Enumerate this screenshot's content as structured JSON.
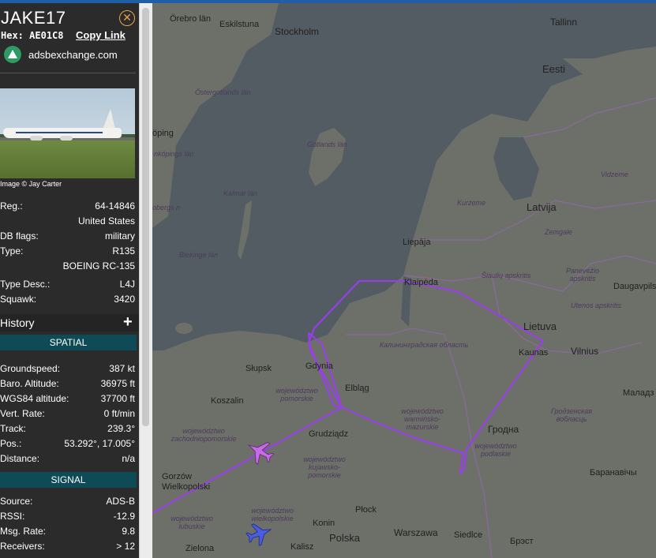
{
  "aircraft": {
    "callsign": "JAKE17",
    "hex_label": "Hex:",
    "hex": "AE01C8",
    "copy_link": "Copy Link",
    "source_site": "adsbexchange.com",
    "photo_credit": "Image © Jay Carter",
    "close_icon": "close-icon"
  },
  "info": [
    {
      "label": "Reg.:",
      "value": "64-14846"
    },
    {
      "label": "",
      "value": "United States"
    },
    {
      "label": "DB flags:",
      "value": "military"
    },
    {
      "label": "Type:",
      "value": "R135"
    },
    {
      "label": "",
      "value": "BOEING RC-135"
    },
    {
      "label": "Type Desc.:",
      "value": "L4J"
    },
    {
      "label": "Squawk:",
      "value": "3420"
    }
  ],
  "history": {
    "label": "History",
    "expand_icon": "+"
  },
  "spatial": {
    "title": "SPATIAL",
    "rows": [
      {
        "label": "Groundspeed:",
        "value": "387 kt"
      },
      {
        "label": "Baro. Altitude:",
        "value": "36975 ft"
      },
      {
        "label": "WGS84 altitude:",
        "value": "37700 ft"
      },
      {
        "label": "Vert. Rate:",
        "value": "0 ft/min"
      },
      {
        "label": "Track:",
        "value": "239.3°"
      },
      {
        "label": "Pos.:",
        "value": "53.292°, 17.005°"
      },
      {
        "label": "Distance:",
        "value": "n/a"
      }
    ]
  },
  "signal": {
    "title": "SIGNAL",
    "rows": [
      {
        "label": "Source:",
        "value": "ADS-B"
      },
      {
        "label": "RSSI:",
        "value": "-12.9"
      },
      {
        "label": "Msg. Rate:",
        "value": "9.8"
      },
      {
        "label": "Receivers:",
        "value": "> 12"
      }
    ]
  },
  "map": {
    "colors": {
      "land": "#6d7069",
      "water": "#545c63",
      "border": "#8a6a9a",
      "track": "#9b3cf0",
      "selected_plane": "#c86ae6",
      "other_plane": "#4a5ce0"
    },
    "labels": {
      "orebro": "Örebro län",
      "eskilstuna": "Eskilstuna",
      "stockholm": "Stockholm",
      "tallinn": "Tallinn",
      "eesti": "Eesti",
      "ostergotlands": "Östergotlands län",
      "gotlands": "Gotlands län",
      "kalmar": "Kalmar län",
      "jonkopings": "nköpings län",
      "oping": "öping",
      "kronobergs": "obergs n",
      "blekinge": "Blekinge län",
      "latvija": "Latvija",
      "vidzeme": "Vidzeme",
      "kurzeme": "Kurzeme",
      "zemgale": "Zemgale",
      "liepaja": "Liepāja",
      "siauliu": "Šiaulių apskritis",
      "panevezio": "Panevėžio apskritis",
      "daugavpils": "Daugavpils",
      "utenos": "Utenos apskritis",
      "klaipeda": "Klaipėda",
      "lietuva": "Lietuva",
      "kaunas": "Kaunas",
      "vilnius": "Vilnius",
      "kaliningrad": "Калининградская область",
      "slupsk": "Słupsk",
      "gdynia": "Gdynia",
      "elblag": "Elbląg",
      "koszalin": "Koszalin",
      "pomorskie": "województwo pomorskie",
      "warminsko": "województwo warmińsko-mazurskie",
      "zachodniopomorskie": "województwo zachodniopomorskie",
      "grudziadz": "Grudziądz",
      "kujawsko": "województwo kujawsko-pomorskie",
      "podlaskie": "województwo podlaskie",
      "grodno": "Гродна",
      "grodzenskaya": "Гродзенская вобласць",
      "malad": "Маладз",
      "baranavichy": "Баранавічы",
      "gorzow": "Gorzów Wielkopolski",
      "lubuskie": "województwo lubuskie",
      "wielkopolskie": "województwo wielkopolskie",
      "plock": "Płock",
      "konin": "Konin",
      "warszawa": "Warszawa",
      "polska": "Polska",
      "siedlce": "Siedlce",
      "brest": "Брэст",
      "zielona": "Zielona",
      "kalisz": "Kalisz"
    }
  }
}
